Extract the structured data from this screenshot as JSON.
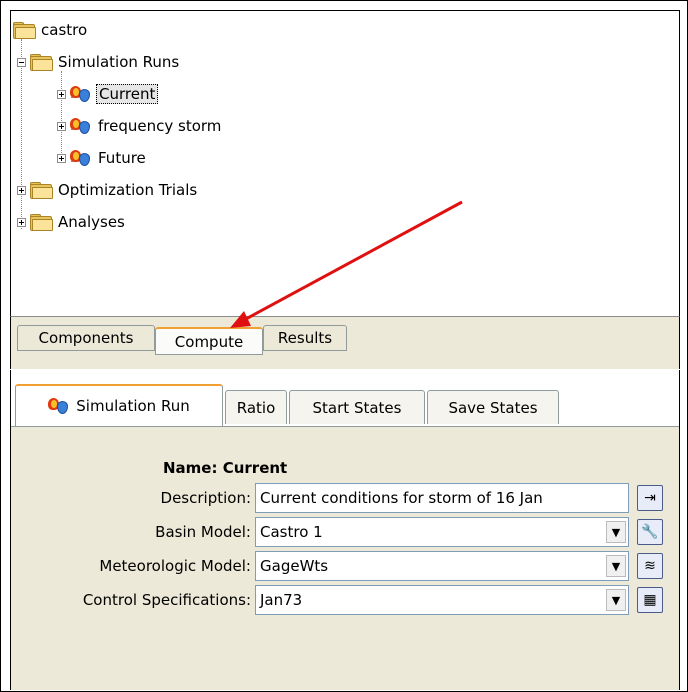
{
  "tree": {
    "root": "castro",
    "simulation_runs": "Simulation Runs",
    "runs": [
      "Current",
      "frequency storm",
      "Future"
    ],
    "optimization": "Optimization Trials",
    "analyses": "Analyses"
  },
  "top_tabs": [
    "Components",
    "Compute",
    "Results"
  ],
  "active_top_tab": "Compute",
  "run_tabs": [
    "Simulation Run",
    "Ratio",
    "Start States",
    "Save States"
  ],
  "active_run_tab": "Simulation Run",
  "form": {
    "name_label": "Name:",
    "name_value": "Current",
    "description_label": "Description:",
    "description_value": "Current conditions for storm of 16 Jan",
    "basin_label": "Basin Model:",
    "basin_value": "Castro 1",
    "met_label": "Meteorologic Model:",
    "met_value": "GageWts",
    "control_label": "Control Specifications:",
    "control_value": "Jan73"
  },
  "colors": {
    "arrow": "#e01010",
    "active_tab_accent": "#f0a030",
    "folder": "#e8c45c"
  }
}
